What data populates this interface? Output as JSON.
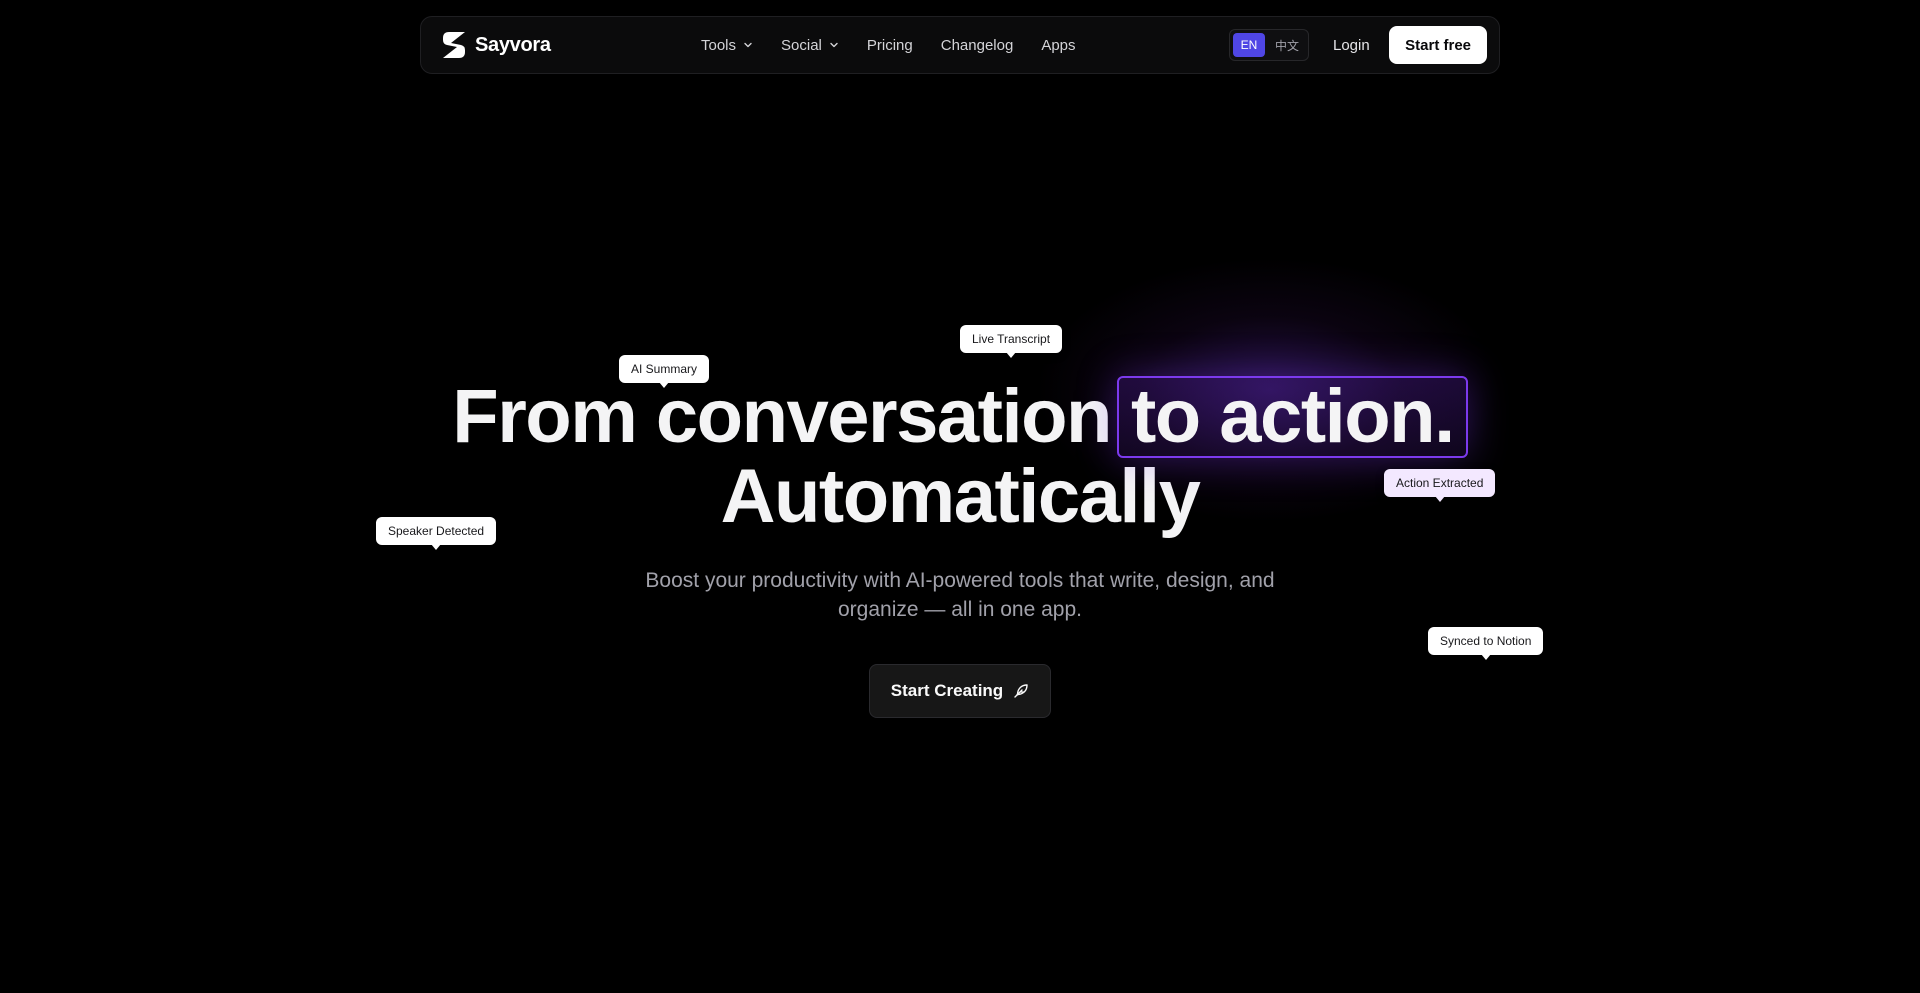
{
  "brand": {
    "name": "Sayvora",
    "logo_icon": "sayvora-s-logo-icon"
  },
  "nav": {
    "links": [
      {
        "label": "Tools",
        "has_dropdown": true
      },
      {
        "label": "Social",
        "has_dropdown": true
      },
      {
        "label": "Pricing",
        "has_dropdown": false
      },
      {
        "label": "Changelog",
        "has_dropdown": false
      },
      {
        "label": "Apps",
        "has_dropdown": false
      }
    ],
    "languages": [
      {
        "label": "EN",
        "active": true
      },
      {
        "label": "中文",
        "active": false
      }
    ],
    "login_label": "Login",
    "start_free_label": "Start free"
  },
  "hero": {
    "headline_part1": "From conversation",
    "headline_highlight": "to action.",
    "headline_line2": "Automatically",
    "subtitle": "Boost your productivity with AI-powered tools that write, design, and organize — all in one app.",
    "cta_label": "Start Creating",
    "cta_icon": "feather-pen-icon"
  },
  "tags": {
    "ai_summary": "AI Summary",
    "live_transcript": "Live Transcript",
    "action_extracted": "Action Extracted",
    "speaker_detected": "Speaker Detected",
    "synced_to_notion": "Synced to Notion"
  },
  "colors": {
    "background": "#000000",
    "navbar_bg": "#0b0b0c",
    "accent_purple": "#7c3aed",
    "lang_active": "#4f46e5",
    "subtitle_text": "#a1a1aa"
  }
}
